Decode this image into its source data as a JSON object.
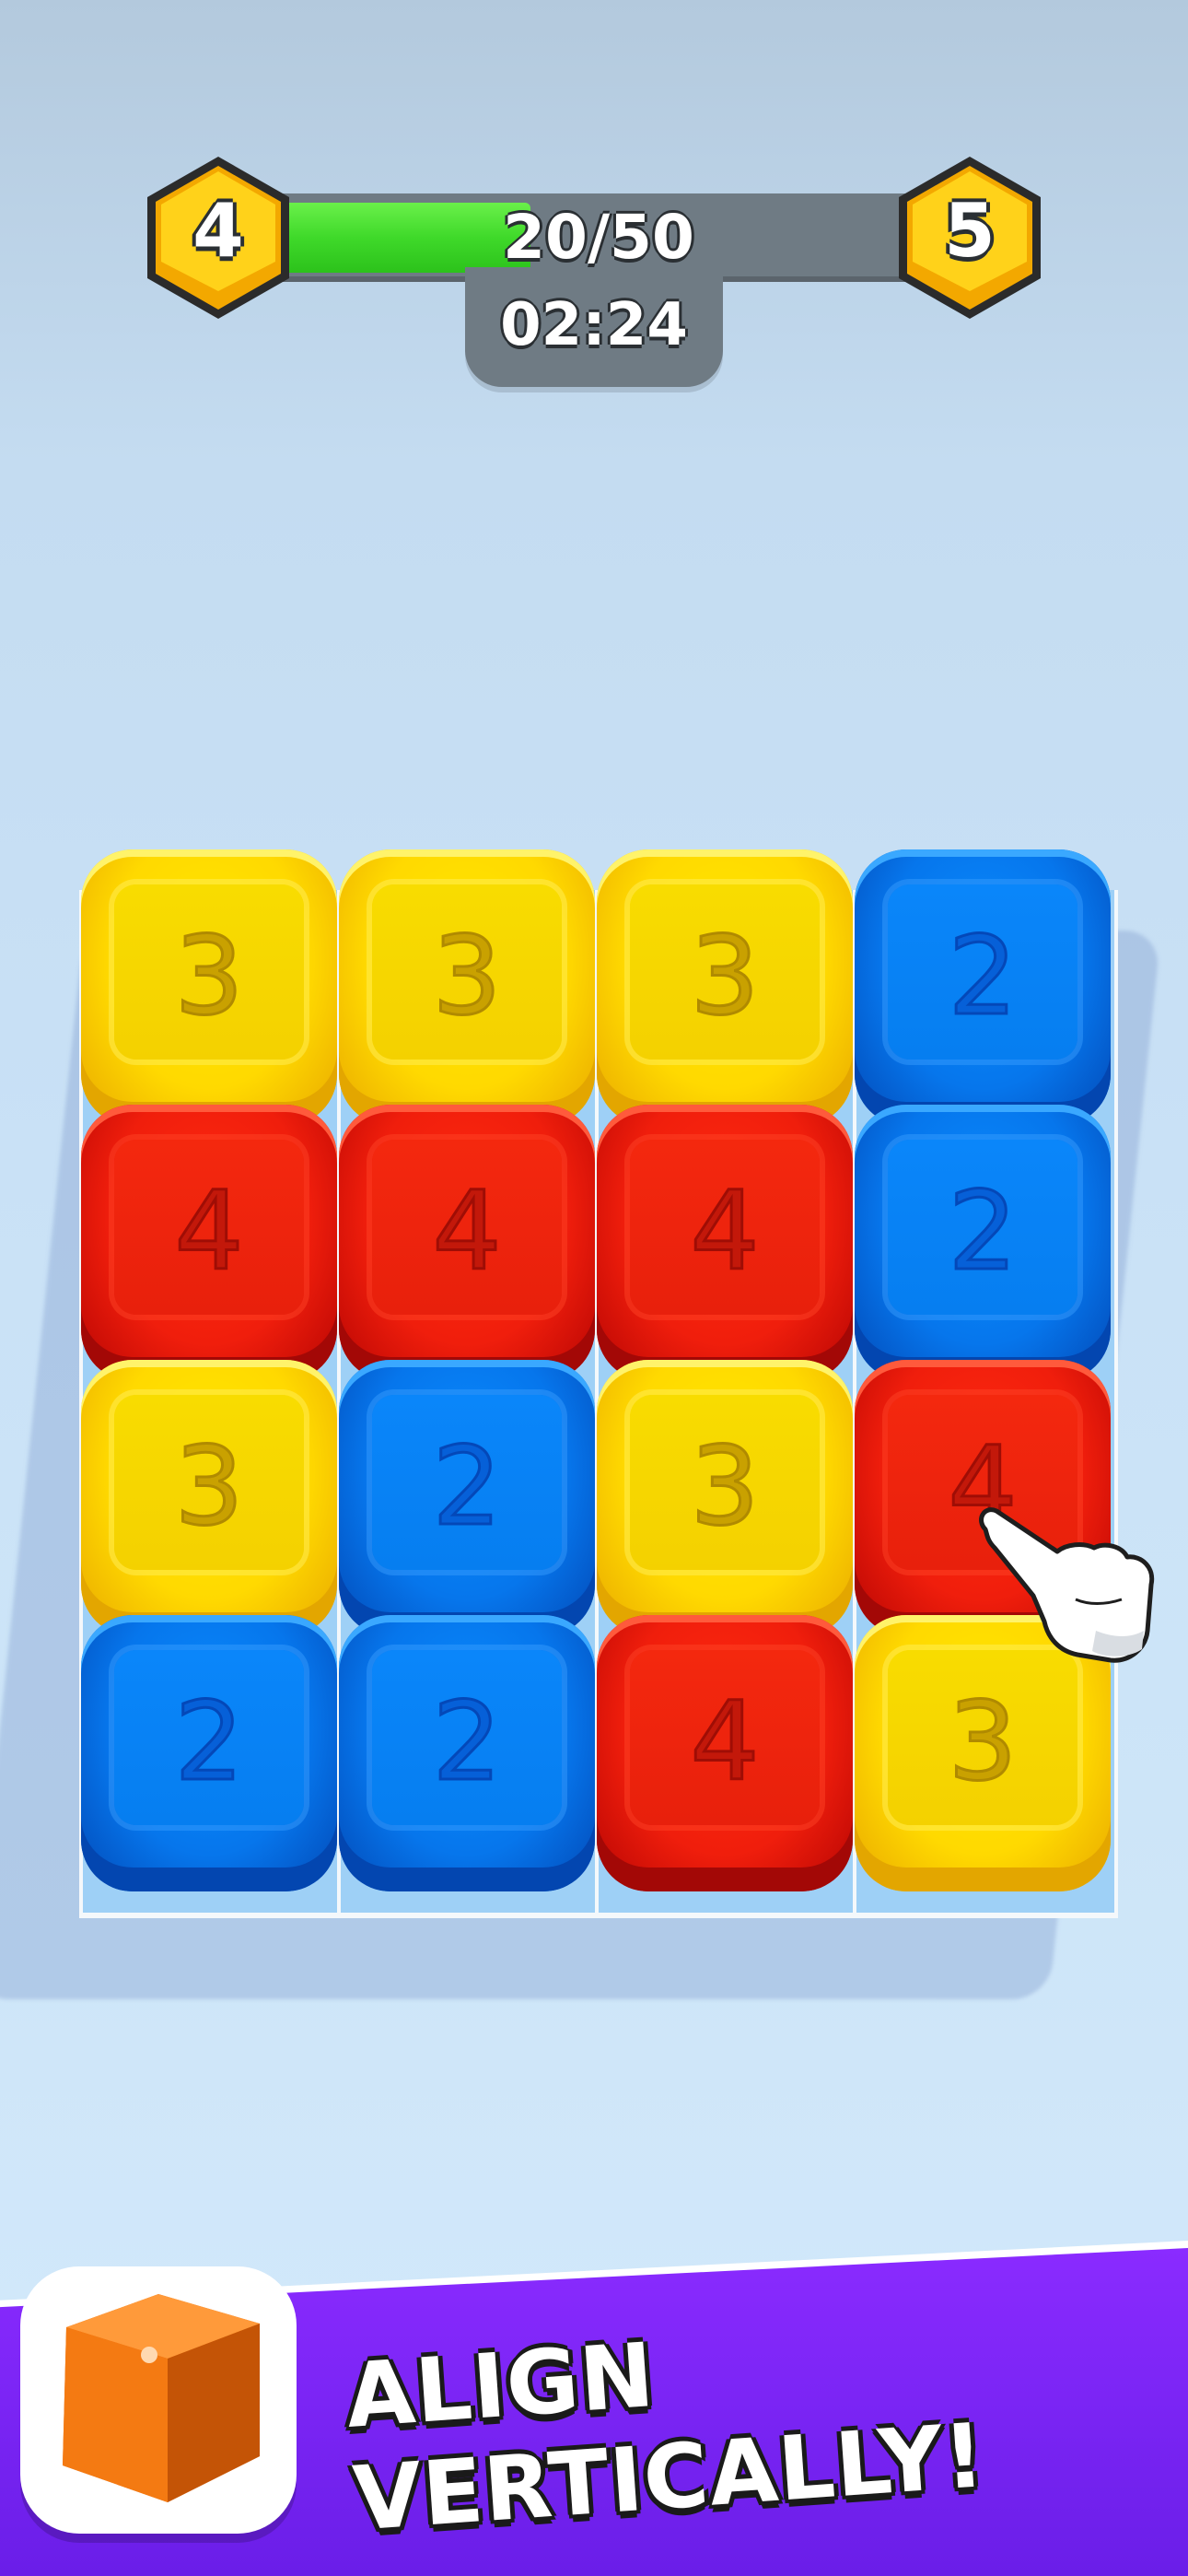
{
  "hud": {
    "current_level": "4",
    "next_level": "5",
    "progress_text": "20/50",
    "progress_value": 20,
    "progress_max": 50,
    "timer": "02:24"
  },
  "board": {
    "rows": [
      [
        {
          "value": "3",
          "color": "yellow"
        },
        {
          "value": "3",
          "color": "yellow"
        },
        {
          "value": "3",
          "color": "yellow"
        },
        {
          "value": "2",
          "color": "blue"
        }
      ],
      [
        {
          "value": "4",
          "color": "red"
        },
        {
          "value": "4",
          "color": "red"
        },
        {
          "value": "4",
          "color": "red"
        },
        {
          "value": "2",
          "color": "blue"
        }
      ],
      [
        {
          "value": "3",
          "color": "yellow"
        },
        {
          "value": "2",
          "color": "blue"
        },
        {
          "value": "3",
          "color": "yellow"
        },
        {
          "value": "4",
          "color": "red"
        }
      ],
      [
        {
          "value": "2",
          "color": "blue"
        },
        {
          "value": "2",
          "color": "blue"
        },
        {
          "value": "4",
          "color": "red"
        },
        {
          "value": "3",
          "color": "yellow"
        }
      ]
    ]
  },
  "pointer": {
    "icon": "pointing-hand-icon"
  },
  "banner": {
    "text": "ALIGN VERTICALLY!",
    "icon": "orange-cube-icon",
    "color": "#7424f5"
  },
  "colors": {
    "yellow": "#ffd900",
    "red": "#f01e0c",
    "blue": "#0676ec",
    "progress_green": "#3fd92a",
    "hud_gray": "#6f7b84"
  }
}
